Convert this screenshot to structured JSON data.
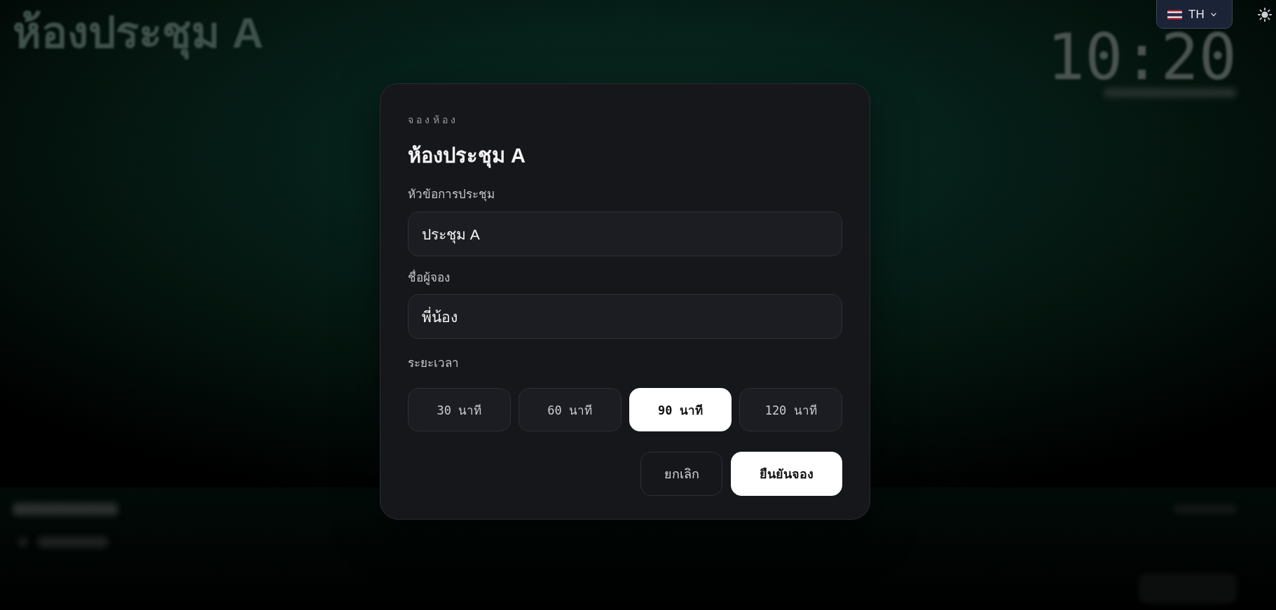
{
  "background": {
    "title": "ห้องประชุม A",
    "clock": "10:20"
  },
  "language_switch": {
    "label": "TH"
  },
  "dialog": {
    "eyebrow": "จองห้อง",
    "title": "ห้องประชุม A",
    "fields": [
      {
        "label": "หัวข้อการประชุม",
        "value": "ประชุม A"
      },
      {
        "label": "ชื่อผู้จอง",
        "value": "พี่น้อง"
      }
    ],
    "duration": {
      "label": "ระยะเวลา",
      "options": [
        {
          "label": "30 นาที",
          "selected": false
        },
        {
          "label": "60 นาที",
          "selected": false
        },
        {
          "label": "90 นาที",
          "selected": true
        },
        {
          "label": "120 นาที",
          "selected": false
        }
      ]
    },
    "buttons": [
      {
        "label": "ยกเลิก",
        "kind": "secondary"
      },
      {
        "label": "ยืนยันจอง",
        "kind": "primary"
      }
    ]
  }
}
